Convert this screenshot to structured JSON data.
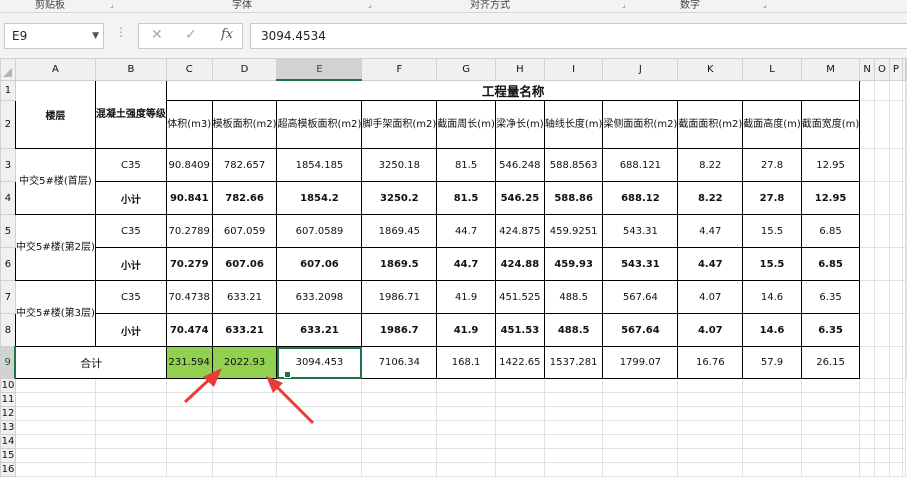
{
  "ribbon": {
    "groups": [
      "剪贴板",
      "字体",
      "对齐方式",
      "数字"
    ]
  },
  "formula_bar": {
    "name_box": "E9",
    "cancel_icon": "✕",
    "enter_icon": "✓",
    "fx_label": "fx",
    "value": "3094.4534"
  },
  "columns": [
    "A",
    "B",
    "C",
    "D",
    "E",
    "F",
    "G",
    "H",
    "I",
    "J",
    "K",
    "L",
    "M",
    "N",
    "O",
    "P"
  ],
  "rows": [
    "1",
    "2",
    "3",
    "4",
    "5",
    "6",
    "7",
    "8",
    "9",
    "10",
    "11",
    "12",
    "13",
    "14",
    "15",
    "16"
  ],
  "active_cell": "E9",
  "table": {
    "title": "工程量名称",
    "floor_header": "楼层",
    "grade_header": "混凝土强度等级",
    "quantity_headers": [
      "体积(m3)",
      "模板面积(m2)",
      "超高模板面积(m2)",
      "脚手架面积(m2)",
      "截面周长(m)",
      "梁净长(m)",
      "轴线长度(m)",
      "梁侧面面积(m2)",
      "截面面积(m2)",
      "截面高度(m)",
      "截面宽度(m)"
    ],
    "groups": [
      {
        "floor": "中交5#楼(首层)",
        "grade": "C35",
        "values": [
          "90.8409",
          "782.657",
          "1854.185",
          "3250.18",
          "81.5",
          "546.248",
          "588.8563",
          "688.121",
          "8.22",
          "27.8",
          "12.95"
        ],
        "subtotal_label": "小计",
        "subtotal": [
          "90.841",
          "782.66",
          "1854.2",
          "3250.2",
          "81.5",
          "546.25",
          "588.86",
          "688.12",
          "8.22",
          "27.8",
          "12.95"
        ]
      },
      {
        "floor": "中交5#楼(第2层)",
        "grade": "C35",
        "values": [
          "70.2789",
          "607.059",
          "607.0589",
          "1869.45",
          "44.7",
          "424.875",
          "459.9251",
          "543.31",
          "4.47",
          "15.5",
          "6.85"
        ],
        "subtotal_label": "小计",
        "subtotal": [
          "70.279",
          "607.06",
          "607.06",
          "1869.5",
          "44.7",
          "424.88",
          "459.93",
          "543.31",
          "4.47",
          "15.5",
          "6.85"
        ]
      },
      {
        "floor": "中交5#楼(第3层)",
        "grade": "C35",
        "values": [
          "70.4738",
          "633.21",
          "633.2098",
          "1986.71",
          "41.9",
          "451.525",
          "488.5",
          "567.64",
          "4.07",
          "14.6",
          "6.35"
        ],
        "subtotal_label": "小计",
        "subtotal": [
          "70.474",
          "633.21",
          "633.21",
          "1986.7",
          "41.9",
          "451.53",
          "488.5",
          "567.64",
          "4.07",
          "14.6",
          "6.35"
        ]
      }
    ],
    "total_label": "合计",
    "total": [
      "231.594",
      "2022.93",
      "3094.453",
      "7106.34",
      "168.1",
      "1422.65",
      "1537.281",
      "1799.07",
      "16.76",
      "57.9",
      "26.15"
    ]
  },
  "colors": {
    "highlight_fill": "#92d050",
    "selection_green": "#217346",
    "arrow_red": "#ea3a3a"
  }
}
